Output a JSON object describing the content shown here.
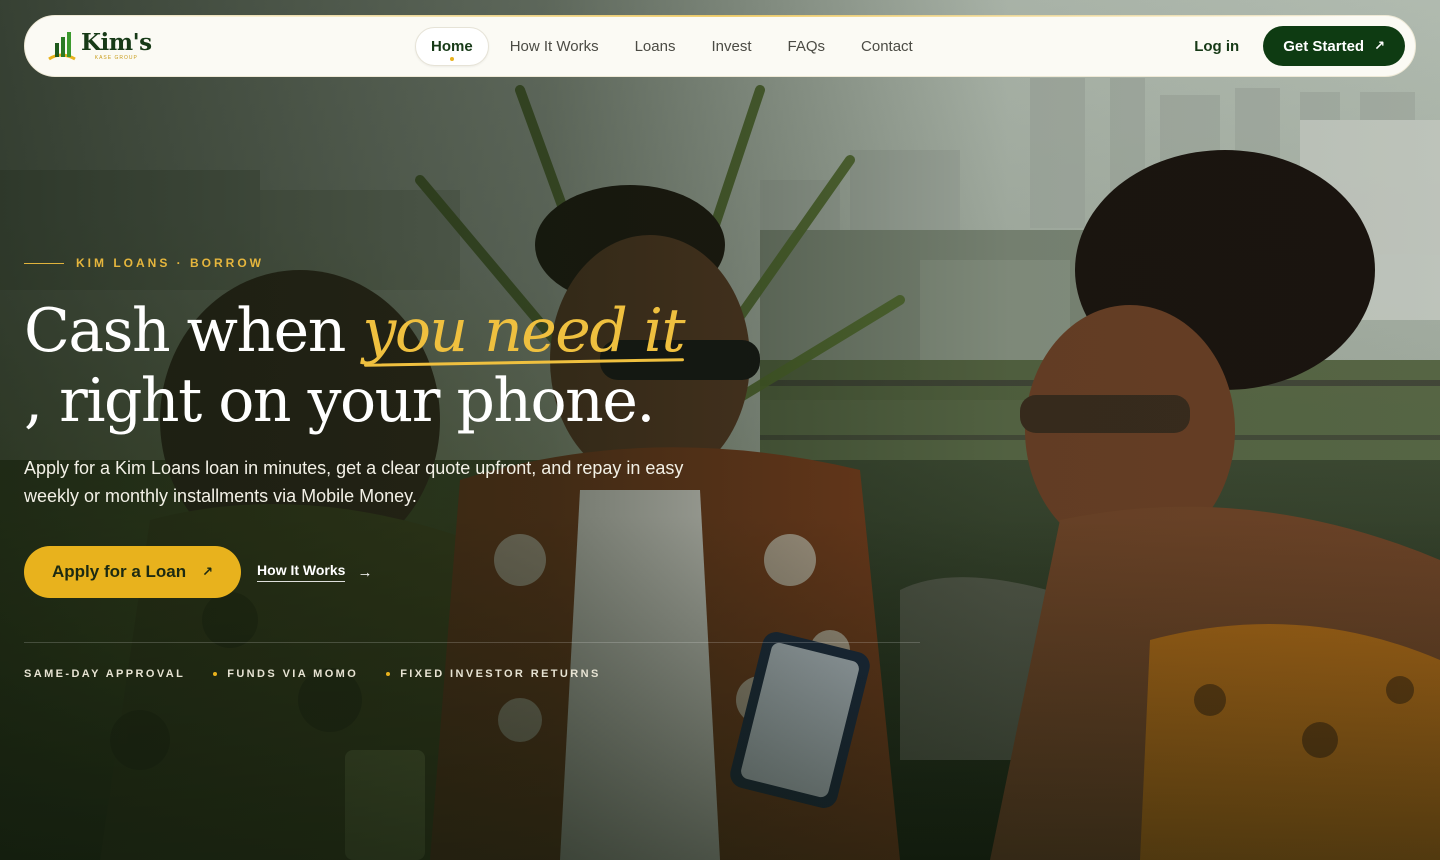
{
  "brand": {
    "name": "Kim's",
    "subtitle": "KASE GROUP",
    "colors": {
      "primary": "#0e3b12",
      "accent": "#e8b21d",
      "header_bg": "#fbfaf4"
    }
  },
  "nav": {
    "items": [
      {
        "label": "Home",
        "active": true
      },
      {
        "label": "How It Works",
        "active": false
      },
      {
        "label": "Loans",
        "active": false
      },
      {
        "label": "Invest",
        "active": false
      },
      {
        "label": "FAQs",
        "active": false
      },
      {
        "label": "Contact",
        "active": false
      }
    ],
    "login_label": "Log in",
    "cta_label": "Get Started",
    "cta_icon": "arrow-up-right-icon"
  },
  "hero": {
    "eyebrow": "KIM LOANS · BORROW",
    "headline_line1_plain": "Cash when ",
    "headline_line1_accent": "you need it",
    "headline_line2": ", right on your phone.",
    "lede": "Apply for a Kim Loans loan in minutes, get a clear quote upfront, and repay in easy weekly or monthly installments via Mobile Money.",
    "primary_cta": "Apply for a Loan",
    "primary_cta_icon": "arrow-up-right-icon",
    "secondary_cta": "How It Works",
    "secondary_cta_icon": "arrow-right-icon",
    "features": [
      "SAME-DAY APPROVAL",
      "FUNDS VIA MOMO",
      "FIXED INVESTOR RETURNS"
    ],
    "background_image": "friends-on-rooftop-with-phone"
  }
}
